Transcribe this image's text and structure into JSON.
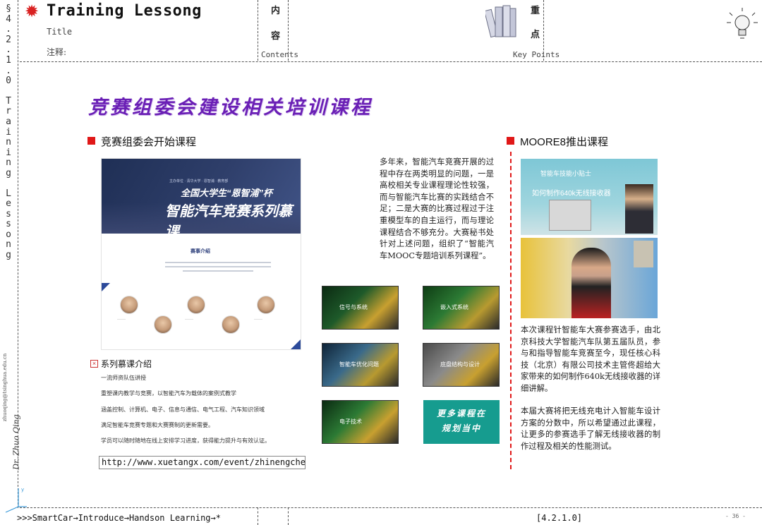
{
  "header": {
    "title": "Training Lessong",
    "subtitle": "Title",
    "note": "注释:",
    "contents_chars": [
      "内",
      "容"
    ],
    "contents_label": "Contents",
    "keypoints_chars": [
      "重",
      "点"
    ],
    "keypoints_label": "Key Points"
  },
  "rail": {
    "chars": [
      "§",
      "4",
      ".",
      "2",
      ".",
      "1",
      ".",
      "0",
      "",
      "T",
      "r",
      "a",
      "i",
      "n",
      "i",
      "n",
      "g",
      "",
      "L",
      "e",
      "s",
      "s",
      "o",
      "n",
      "g"
    ],
    "author": "Dr. Zhuo Qing",
    "email": "zhuoqing@tsinghua.edu.cn"
  },
  "main": {
    "title": "竞赛组委会建设相关培训课程",
    "left_section": "竞赛组委会开始课程",
    "right_section": "MOORE8推出课程",
    "poster": {
      "small": "主办单位 · 清华大学 · 恩智浦 · 教育部",
      "headline1": "全国大学生“恩智浦”杯",
      "headline2": "智能汽车竞赛系列慕课",
      "intro": "赛事介绍"
    },
    "para1": "多年来，智能汽车竞赛开展的过程中存在两类明显的问题，一是高校相关专业课程理论性较强，而与智能汽车比赛的实践结合不足；二是大赛的比赛过程过于注重模型车的自主运行，而与理论课程结合不够充分。大赛秘书处针对上述问题，组织了“智能汽车MOOC专题培训系列课程”。",
    "thumbs": [
      "信号与系统",
      "嵌入式系统",
      "智能车优化问题",
      "底盘结构与设计",
      "电子技术"
    ],
    "more_courses": [
      "更多课程在",
      "规划当中"
    ],
    "series_title": "系列慕课介绍",
    "series_lines": [
      "一流师资队伍讲授",
      "重塑课内教学与竞赛，以智能汽车为载体的案例式教学",
      "涵盖控制、计算机、电子、信息与通信、电气工程、汽车知识领域",
      "满足智能车竞赛专题和大赛赛制的更新需要。",
      "学员可以随时随地在线上安排学习进度，获得能力提升与有效认证。"
    ],
    "url": "http://www.xuetangx.com/event/zhinengche",
    "video_top_line1": "智能车技能小贴士",
    "video_top_line2": "如何制作640k无线接收器",
    "para2": "本次课程针智能车大赛参赛选手，由北京科技大学智能汽车队第五届队员，参与和指导智能车竞赛至今，现任核心科技（北京）有限公司技术主管佟超给大家带来的如何制作640k无线接收器的详细讲解。",
    "para3": "本届大赛将把无线充电计入智能车设计方案的分数中，所以希望通过此课程，让更多的参赛选手了解无线接收器的制作过程及相关的性能测试。"
  },
  "footer": {
    "breadcrumb": ">>>SmartCar→Introduce→Handson Learning→*",
    "section": "[4.2.1.0]",
    "page": "- 36 -"
  },
  "colors": {
    "title_purple": "#6a1fb5",
    "accent_red": "#e01818",
    "teal": "#169c8f"
  }
}
